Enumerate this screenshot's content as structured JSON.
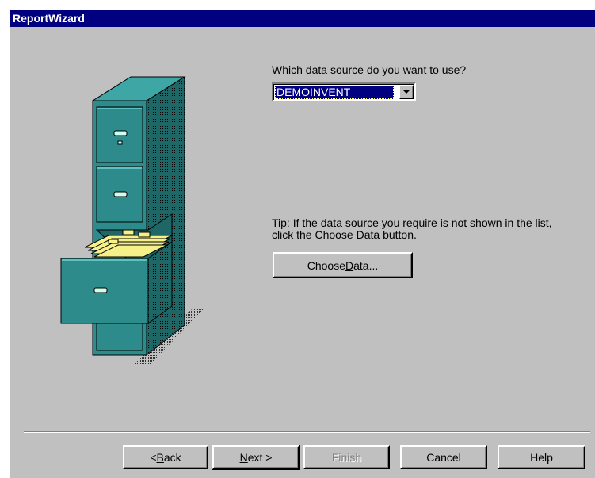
{
  "window": {
    "title": "ReportWizard"
  },
  "prompt": {
    "question_pre": "Which ",
    "question_accel": "d",
    "question_post": "ata source do you want to use?"
  },
  "datasource_combo": {
    "selected": "DEMOINVENT"
  },
  "tip": "Tip: If the data source you require is not shown in the list, click the Choose Data button.",
  "choose_data_button": {
    "pre": "Choose ",
    "accel": "D",
    "post": "ata..."
  },
  "nav": {
    "back": {
      "pre": "< ",
      "accel": "B",
      "post": "ack"
    },
    "next": {
      "accel": "N",
      "post": "ext >"
    },
    "finish": "Finish",
    "cancel": "Cancel",
    "help": "Help"
  },
  "icons": {
    "cabinet": "filing-cabinet-illustration",
    "combo_arrow": "chevron-down-icon"
  },
  "colors": {
    "title_bar": "#000080",
    "dialog_bg": "#c0c0c0",
    "selection": "#000080",
    "cabinet": "#2e8b8b",
    "folders": "#f5f08a"
  }
}
